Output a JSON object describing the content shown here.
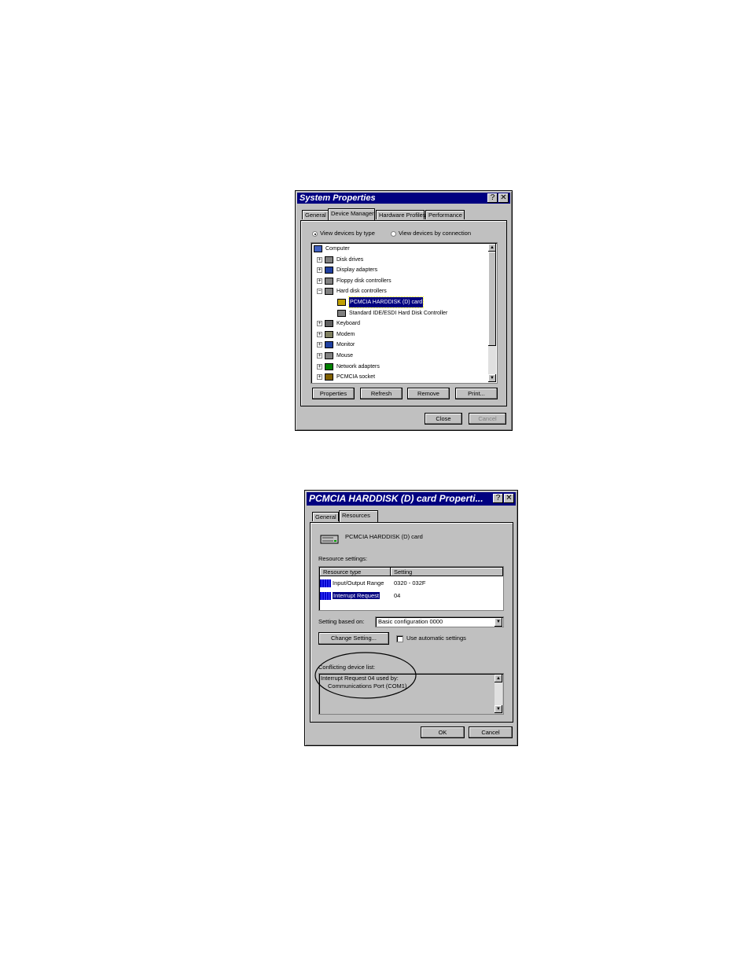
{
  "system_properties": {
    "title": "System Properties",
    "help_btn": "?",
    "close_btn": "✕",
    "tabs": [
      "General",
      "Device Manager",
      "Hardware Profiles",
      "Performance"
    ],
    "radio_type": "View devices by type",
    "radio_connection": "View devices by connection",
    "tree": [
      {
        "label": "Computer",
        "icon": "computer-icon"
      },
      {
        "label": "Disk drives",
        "icon": "disk-drive-icon"
      },
      {
        "label": "Display adapters",
        "icon": "display-adapter-icon"
      },
      {
        "label": "Floppy disk controllers",
        "icon": "floppy-controller-icon"
      },
      {
        "label": "Hard disk controllers",
        "icon": "hard-disk-controller-icon"
      },
      {
        "label": "PCMCIA HARDDISK (D) card",
        "icon": "warning-disk-icon"
      },
      {
        "label": "Standard IDE/ESDI Hard Disk Controller",
        "icon": "hdd-controller-icon"
      },
      {
        "label": "Keyboard",
        "icon": "keyboard-icon"
      },
      {
        "label": "Modem",
        "icon": "modem-icon"
      },
      {
        "label": "Monitor",
        "icon": "monitor-icon"
      },
      {
        "label": "Mouse",
        "icon": "mouse-icon"
      },
      {
        "label": "Network adapters",
        "icon": "network-adapter-icon"
      },
      {
        "label": "PCMCIA socket",
        "icon": "pcmcia-socket-icon"
      }
    ],
    "buttons": {
      "properties": "Properties",
      "refresh": "Refresh",
      "remove": "Remove",
      "print": "Print..."
    },
    "footer": {
      "close": "Close",
      "cancel": "Cancel"
    }
  },
  "card_properties": {
    "title": "PCMCIA HARDDISK (D) card Properti...",
    "help_btn": "?",
    "close_btn": "✕",
    "tabs": [
      "General",
      "Resources"
    ],
    "device_name": "PCMCIA HARDDISK (D) card",
    "resource_settings_label": "Resource settings:",
    "col_type": "Resource type",
    "col_setting": "Setting",
    "rows": [
      {
        "type": "Input/Output Range",
        "setting": "0320 - 032F"
      },
      {
        "type": "Interrupt Request",
        "setting": "04"
      }
    ],
    "setting_based_label": "Setting based on:",
    "setting_based_value": "Basic configuration 0000",
    "change_setting": "Change Setting...",
    "use_auto": "Use automatic settings",
    "conflict_label": "Conflicting device list:",
    "conflict_line1": "Interrupt Request 04 used by:",
    "conflict_line2": "Communications Port (COM1)",
    "footer": {
      "ok": "OK",
      "cancel": "Cancel"
    }
  }
}
